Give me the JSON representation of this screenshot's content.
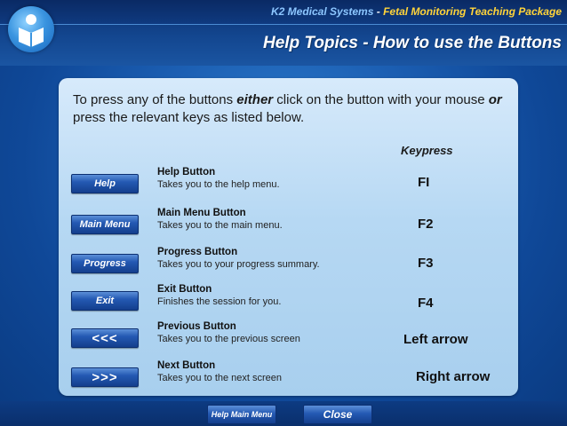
{
  "header": {
    "company": "K2 Medical Systems",
    "separator": " - ",
    "package": "Fetal Monitoring Teaching Package",
    "title": "Help Topics - How to use the Buttons",
    "logo_icon": "k2-person-logo-icon"
  },
  "panel": {
    "intro_part1": "To press any of the buttons ",
    "intro_either": "either",
    "intro_part2": " click on the button with your mouse ",
    "intro_or": "or",
    "intro_part3": " press the relevant keys as listed below.",
    "keypress_header": "Keypress",
    "rows": [
      {
        "button": "Help",
        "title": "Help Button",
        "desc": "Takes you to the help menu.",
        "key": "FI"
      },
      {
        "button": "Main Menu",
        "title": "Main Menu Button",
        "desc": "Takes you to the main menu.",
        "key": "F2"
      },
      {
        "button": "Progress",
        "title": "Progress Button",
        "desc": "Takes you to your progress summary.",
        "key": "F3"
      },
      {
        "button": "Exit",
        "title": "Exit Button",
        "desc": "Finishes the session for you.",
        "key": "F4"
      },
      {
        "button": "<<<",
        "title": "Previous Button",
        "desc": "Takes you to the previous screen",
        "key": "Left arrow"
      },
      {
        "button": ">>>",
        "title": "Next Button",
        "desc": "Takes you to the next screen",
        "key": "Right arrow"
      }
    ]
  },
  "footer": {
    "help_main_menu": "Help Main Menu",
    "close": "Close"
  },
  "colors": {
    "background": "#1c5fb3",
    "panel": "#b6d8f3",
    "button": "#2459b3",
    "package_text": "#ffd43a",
    "company_text": "#8cc6ff"
  }
}
